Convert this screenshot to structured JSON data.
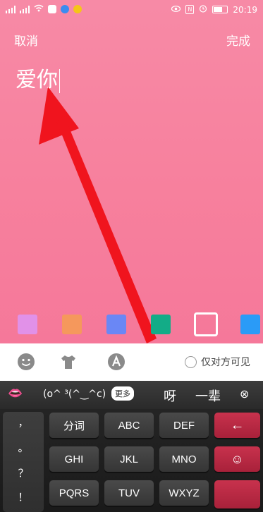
{
  "status": {
    "time": "20:19"
  },
  "topbar": {
    "cancel": "取消",
    "done": "完成"
  },
  "editor": {
    "text": "爱你"
  },
  "colors": {
    "swatches": [
      "#e191e8",
      "#f5985c",
      "#6a87f5",
      "#13ac87",
      "selected",
      "#2a9bf7"
    ],
    "arrow": "#f0141e"
  },
  "toolbar": {
    "emoji_icon": "emoji-icon",
    "shirt_icon": "shirt-icon",
    "font_icon": "font-icon",
    "visible_label": "仅对方可见"
  },
  "candidates": {
    "lips": "👄",
    "kaomoji": "(o^ ³(^‿^c)",
    "more": "更多",
    "c1": "呀",
    "c2": "一辈",
    "close": "⊗"
  },
  "keyboard": {
    "punct": [
      "，",
      "。",
      "？",
      "！"
    ],
    "row1": [
      "分词",
      "ABC",
      "DEF"
    ],
    "row2": [
      "GHI",
      "JKL",
      "MNO"
    ],
    "row3": [
      "PQRS",
      "TUV",
      "WXYZ"
    ],
    "backspace": "←",
    "emoji": "☺"
  }
}
